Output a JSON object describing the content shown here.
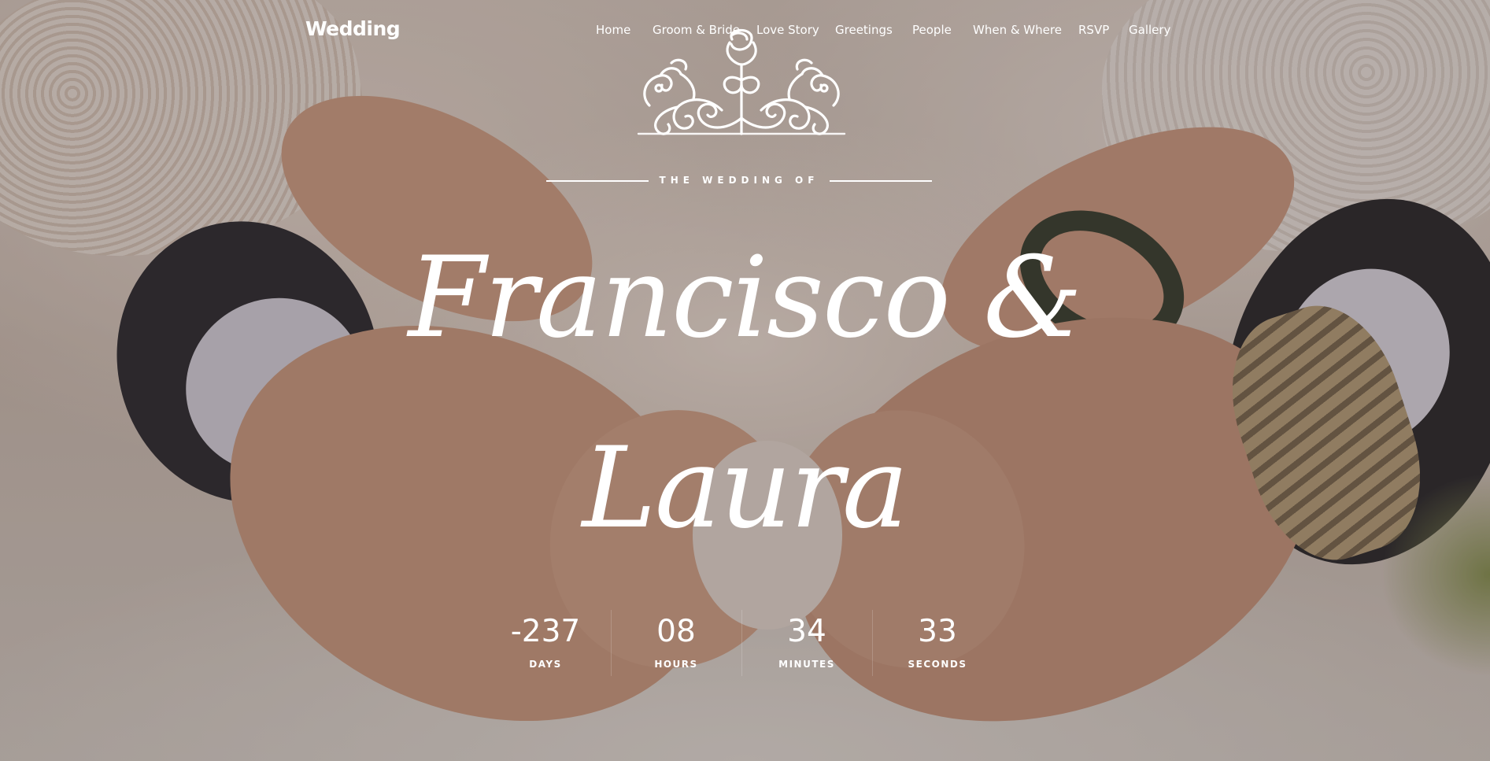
{
  "brand": {
    "name": "Wedding"
  },
  "nav": {
    "items": [
      {
        "label": "Home"
      },
      {
        "label": "Groom & Bride"
      },
      {
        "label": "Love Story"
      },
      {
        "label": "Greetings"
      },
      {
        "label": "People"
      },
      {
        "label": "When & Where"
      },
      {
        "label": "RSVP"
      },
      {
        "label": "Gallery"
      }
    ]
  },
  "hero": {
    "ornament_icon": "floral-flourish-icon",
    "subtitle": "THE WEDDING OF",
    "names_line1": "Francisco &",
    "names_line2": "Laura"
  },
  "countdown": {
    "days": {
      "value": "-237",
      "label": "DAYS"
    },
    "hours": {
      "value": "08",
      "label": "HOURS"
    },
    "minutes": {
      "value": "34",
      "label": "MINUTES"
    },
    "seconds": {
      "value": "33",
      "label": "SECONDS"
    }
  },
  "colors": {
    "text": "#ffffff",
    "overlay": "#281a14"
  }
}
